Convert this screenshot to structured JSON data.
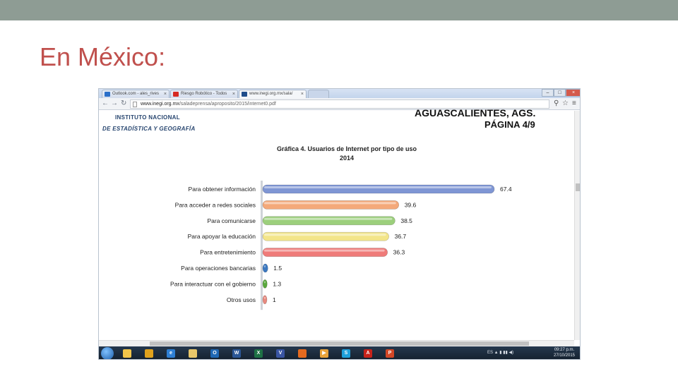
{
  "slide": {
    "title": "En México:",
    "band_color": "#8e9c94",
    "title_color": "#c0504d"
  },
  "browser": {
    "tabs": [
      {
        "label": "Outlook.com - ales_rives",
        "favicon": "outlook-favicon",
        "color": "#2a6fc9"
      },
      {
        "label": "Riesgo Robótico - Todos",
        "favicon": "youtube-favicon",
        "color": "#d62a22"
      },
      {
        "label": "www.inegi.org.mx/sala/",
        "favicon": "inegi-favicon",
        "color": "#1f4d8b"
      }
    ],
    "tab_close": "×",
    "url_host": "www.inegi.org.mx",
    "url_path": "/saladeprensa/aproposito/2015/internet0.pdf",
    "window_buttons": [
      "–",
      "□",
      "×"
    ]
  },
  "document": {
    "org_line1": "INSTITUTO NACIONAL",
    "org_line2": "DE ESTADÍSTICA Y GEOGRAFÍA",
    "header_line1": "AGUASCALIENTES, AGS.",
    "header_line2": "PÁGINA 4/9"
  },
  "chart_data": {
    "type": "bar",
    "orientation": "horizontal",
    "title": "Gráfica 4. Usuarios de Internet por tipo de uso",
    "subtitle": "2014",
    "categories": [
      "Para obtener información",
      "Para acceder a redes sociales",
      "Para comunicarse",
      "Para apoyar la educación",
      "Para entretenimiento",
      "Para operaciones bancarias",
      "Para interactuar con el gobierno",
      "Otros usos"
    ],
    "values": [
      67.4,
      39.6,
      38.5,
      36.7,
      36.3,
      1.5,
      1.3,
      1
    ],
    "data_labels": [
      "67.4",
      "39.6",
      "38.5",
      "36.7",
      "36.3",
      "1.5",
      "1.3",
      "1"
    ],
    "colors": [
      "#7f96d4",
      "#f4a97a",
      "#9ccf7c",
      "#f3e58a",
      "#ef7b79",
      "#3b78c0",
      "#5aa83d",
      "#e8897f"
    ],
    "xlim": [
      0,
      70
    ],
    "grid": false,
    "legend": "none"
  },
  "taskbar": {
    "apps": [
      {
        "icon": "windows-explorer-icon",
        "color": "#f2c54a",
        "glyph": ""
      },
      {
        "icon": "chrome-icon",
        "color": "#e0a21d",
        "glyph": ""
      },
      {
        "icon": "internet-explorer-icon",
        "color": "#2e7fd4",
        "glyph": "e"
      },
      {
        "icon": "file-folder-icon",
        "color": "#e8c76a",
        "glyph": ""
      },
      {
        "icon": "outlook-icon",
        "color": "#1f68b4",
        "glyph": "O"
      },
      {
        "icon": "word-icon",
        "color": "#2b5797",
        "glyph": "W"
      },
      {
        "icon": "excel-icon",
        "color": "#1e7145",
        "glyph": "X"
      },
      {
        "icon": "visio-icon",
        "color": "#3955a3",
        "glyph": "V"
      },
      {
        "icon": "firefox-icon",
        "color": "#e56a1f",
        "glyph": ""
      },
      {
        "icon": "media-player-icon",
        "color": "#e7a33b",
        "glyph": "▶"
      },
      {
        "icon": "skype-icon",
        "color": "#1ea0db",
        "glyph": "S"
      },
      {
        "icon": "acrobat-icon",
        "color": "#c7231b",
        "glyph": "A"
      },
      {
        "icon": "powerpoint-icon",
        "color": "#d24726",
        "glyph": "P"
      }
    ],
    "tray_text": "ES ▲ ▮ ▮▮ ◀)",
    "time": "09:27 p.m.",
    "date": "27/10/2015"
  }
}
